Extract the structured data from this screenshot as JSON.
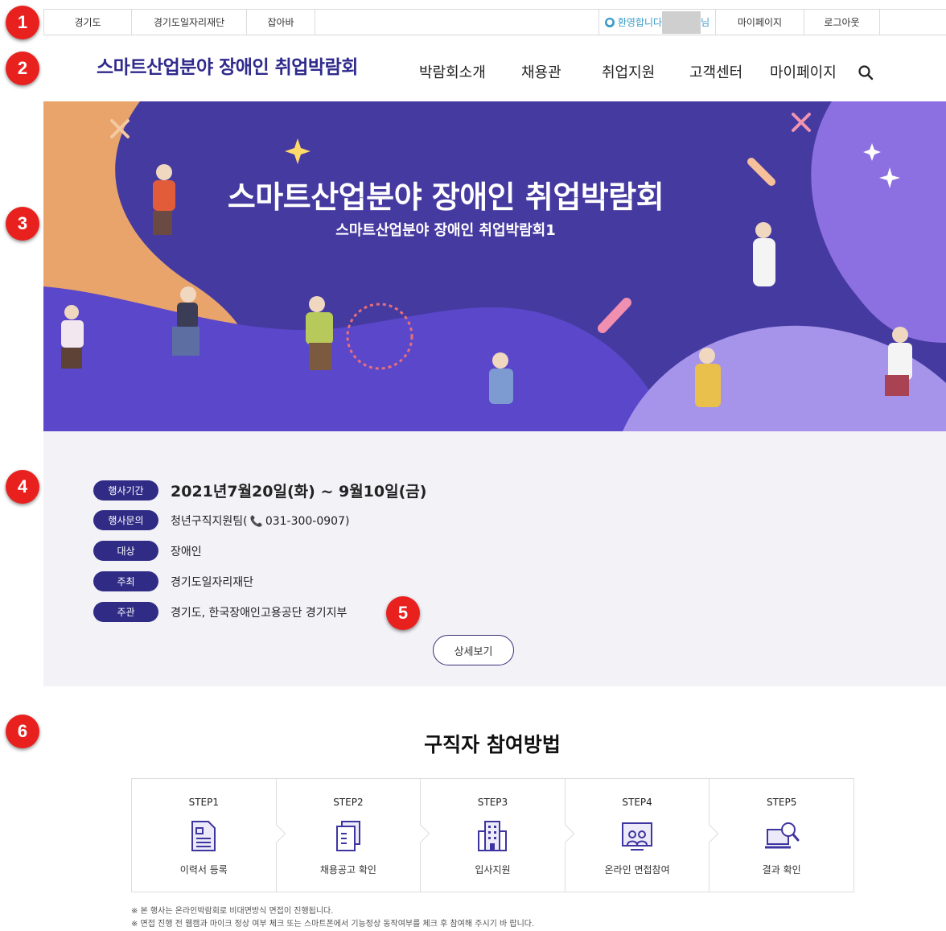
{
  "markers": [
    "1",
    "2",
    "3",
    "4",
    "5",
    "6"
  ],
  "util_bar": {
    "links": [
      "경기도",
      "경기도일자리재단",
      "잡아바"
    ],
    "welcome_prefix": "환영합니다",
    "welcome_suffix": "님",
    "mypage": "마이페이지",
    "logout": "로그아웃"
  },
  "header": {
    "logo": "스마트산업분야 장애인 취업박람회",
    "nav": [
      "박람회소개",
      "채용관",
      "취업지원",
      "고객센터",
      "마이페이지"
    ],
    "search_icon": "search-icon"
  },
  "banner": {
    "title": "스마트산업분야 장애인 취업박람회",
    "subtitle": "스마트산업분야 장애인 취업박람회1"
  },
  "event_info": {
    "rows": [
      {
        "label": "행사기간",
        "value": "2021년7월20일(화) ~ 9월10일(금)"
      },
      {
        "label": "행사문의",
        "value_prefix": "청년구직지원팀(",
        "phone": "031-300-0907)"
      },
      {
        "label": "대상",
        "value": "장애인"
      },
      {
        "label": "주최",
        "value": "경기도일자리재단"
      },
      {
        "label": "주관",
        "value": "경기도, 한국장애인고용공단 경기지부"
      }
    ],
    "detail_button": "상세보기"
  },
  "participation": {
    "title": "구직자 참여방법",
    "steps": [
      {
        "no": "STEP1",
        "label": "이력서 등록",
        "icon": "resume-icon"
      },
      {
        "no": "STEP2",
        "label": "채용공고 확인",
        "icon": "documents-icon"
      },
      {
        "no": "STEP3",
        "label": "입사지원",
        "icon": "building-icon"
      },
      {
        "no": "STEP4",
        "label": "온라인 면접참여",
        "icon": "video-interview-icon"
      },
      {
        "no": "STEP5",
        "label": "결과 확인",
        "icon": "magnifier-laptop-icon"
      }
    ],
    "notes": [
      "※ 본 행사는 온라인박람회로 비대면방식 면접이 진행됩니다.",
      "※ 면접 진행 전 웹캠과 마이크 정상 여부 체크 또는 스마트폰에서 기능정상 동작여부를 체크 후 참여해 주시기 바 랍니다."
    ]
  },
  "colors": {
    "brand": "#2f2a8c",
    "pill": "#302c86",
    "marker": "#e8211f",
    "banner_bg": "#453aa0",
    "info_bg": "#f2f2f7"
  }
}
